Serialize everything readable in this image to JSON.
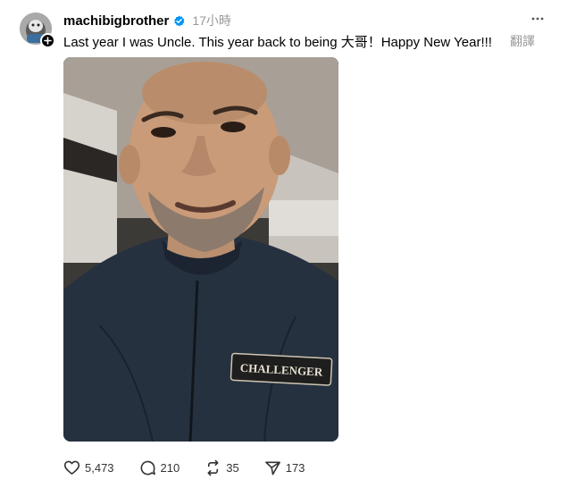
{
  "post": {
    "author": {
      "username": "machibigbrother",
      "verified": true,
      "avatar_icon": "avatar-icon"
    },
    "timestamp": "17小時",
    "caption": "Last year I was Uncle. This year back to being 大哥！Happy New Year!!!",
    "translate_label": "翻譯",
    "media": {
      "type": "photo",
      "jacket_patch_text": "CHALLENGER"
    },
    "stats": {
      "likes": "5,473",
      "replies": "210",
      "reposts": "35",
      "shares": "173"
    }
  },
  "colors": {
    "verified_blue": "#0095f6",
    "muted_text": "#999999"
  }
}
